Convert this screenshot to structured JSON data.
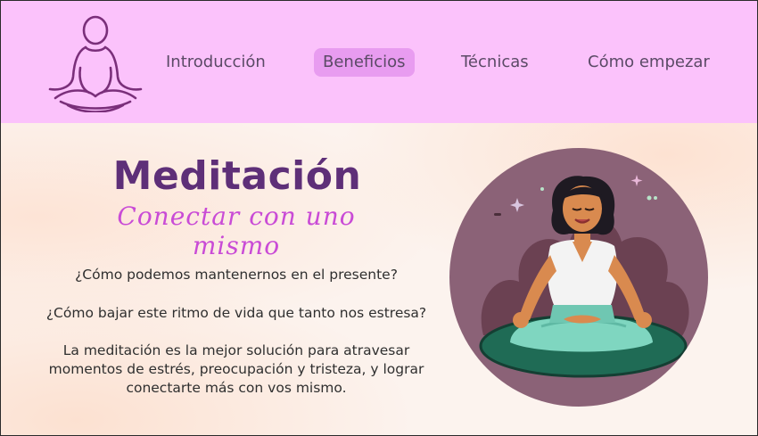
{
  "nav": {
    "items": [
      {
        "label": "Introducción"
      },
      {
        "label": "Beneficios",
        "active": true
      },
      {
        "label": "Técnicas"
      },
      {
        "label": "Cómo empezar"
      }
    ]
  },
  "hero": {
    "title": "Meditación",
    "subtitle": "Conectar con uno mismo",
    "question_1": "¿Cómo podemos mantenernos en el presente?",
    "question_2": "¿Cómo bajar este ritmo de vida que tanto nos estresa?",
    "paragraph_lines": [
      "La meditación es la mejor solución para atravesar",
      "momentos de estrés, preocupación y tristeza, y lograr",
      "conectarte más con vos mismo."
    ]
  },
  "colors": {
    "header_bg": "#fbc2fb",
    "active_tab_bg": "#e89cf0",
    "title": "#5e2f78",
    "subtitle": "#c94bd6",
    "circle_bg": "#8b6277"
  },
  "icons": {
    "logo": "meditating-person-outline-icon",
    "illustration": "meditating-woman-illustration"
  }
}
